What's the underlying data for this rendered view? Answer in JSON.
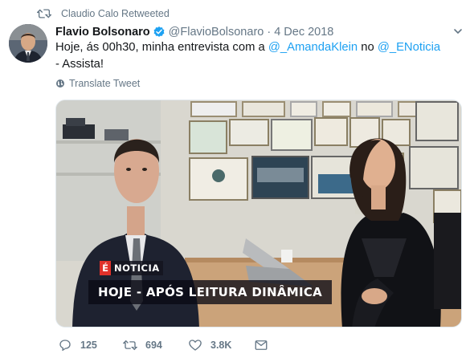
{
  "retweet_banner": {
    "text": "Claudio Calo Retweeted"
  },
  "tweet": {
    "author_name": "Flavio Bolsonaro",
    "handle": "@FlavioBolsonaro",
    "separator": "·",
    "date": "4 Dec 2018",
    "text_part1": "Hoje, ás 00h30, minha entrevista com a ",
    "mention1": "@_AmandaKlein",
    "text_part2": " no ",
    "mention2": "@_ENoticia",
    "text_part3": " - Assista!",
    "translate_label": "Translate Tweet"
  },
  "media": {
    "badge_letter": "É",
    "badge_text": "NOTICIA",
    "caption": "HOJE - APÓS LEITURA DINÂMICA"
  },
  "actions": {
    "replies": "125",
    "retweets": "694",
    "likes": "3.8K"
  },
  "colors": {
    "link": "#1da1f2",
    "secondary_text": "#657786",
    "verified": "#1da1f2",
    "badge_red": "#e0312a"
  },
  "icons": [
    "retweet-icon",
    "verified-badge-icon",
    "chevron-down-icon",
    "globe-icon",
    "reply-icon",
    "like-icon",
    "direct-message-icon"
  ]
}
